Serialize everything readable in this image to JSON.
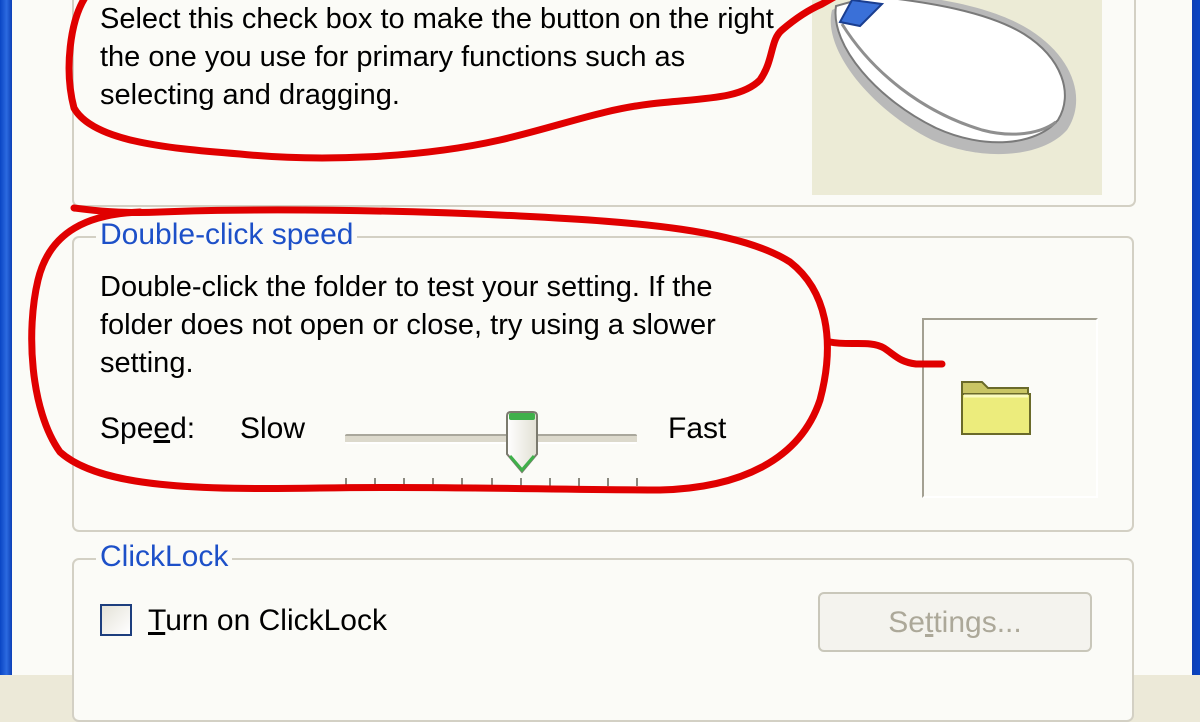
{
  "button_config": {
    "switch_description": "Select this check box to make the button on the right the one you use for primary functions such as selecting and dragging."
  },
  "double_click": {
    "legend": "Double-click speed",
    "description": "Double-click the folder to test your setting. If the folder does not open or close, try using a slower setting.",
    "speed_label_pre": "Spe",
    "speed_label_ul": "e",
    "speed_label_post": "d:",
    "slow_label": "Slow",
    "fast_label": "Fast",
    "speed_value_fraction": 0.6
  },
  "clicklock": {
    "legend": "ClickLock",
    "checkbox_label_ul": "T",
    "checkbox_label_post": "urn on ClickLock",
    "checkbox_checked": false,
    "settings_pre": "Se",
    "settings_ul": "t",
    "settings_post": "tings..."
  },
  "icons": {
    "mouse": "mouse-icon",
    "folder": "folder-icon",
    "slider_thumb": "slider-thumb-icon"
  },
  "colors": {
    "window_frame": "#0a45c4",
    "dialog_bg": "#fbfbf7",
    "legend_text": "#1d50c8",
    "annotation_red": "#e00000",
    "folder_yellow": "#ecec7c"
  }
}
